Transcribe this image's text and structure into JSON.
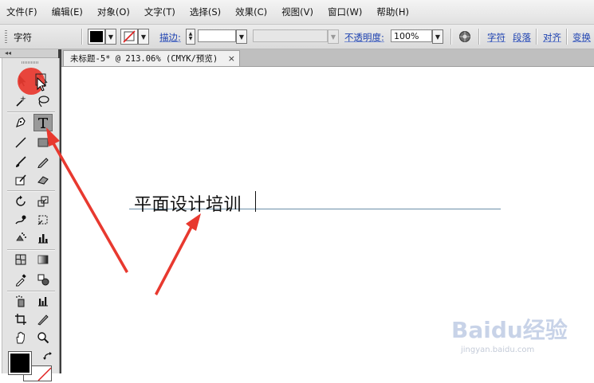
{
  "menu": [
    "文件(F)",
    "编辑(E)",
    "对象(O)",
    "文字(T)",
    "选择(S)",
    "效果(C)",
    "视图(V)",
    "窗口(W)",
    "帮助(H)"
  ],
  "control_bar": {
    "panel_name": "字符",
    "stroke_label": "描边:",
    "opacity_label": "不透明度:",
    "opacity_value": "100%",
    "links": [
      "字符",
      "段落",
      "对齐",
      "变换"
    ]
  },
  "toolbox": {
    "collapse_arrows": "◂◂"
  },
  "document": {
    "tab_title": "未标题-5* @ 213.06% (CMYK/预览)",
    "close_glyph": "×",
    "text_content": "平面设计培训"
  },
  "watermark": {
    "brand": "Baidu经验",
    "url": "jingyan.baidu.com"
  },
  "colors": {
    "annotation_red": "#e8392f",
    "fill_color": "#000000",
    "link_blue": "#1a3fb0"
  }
}
